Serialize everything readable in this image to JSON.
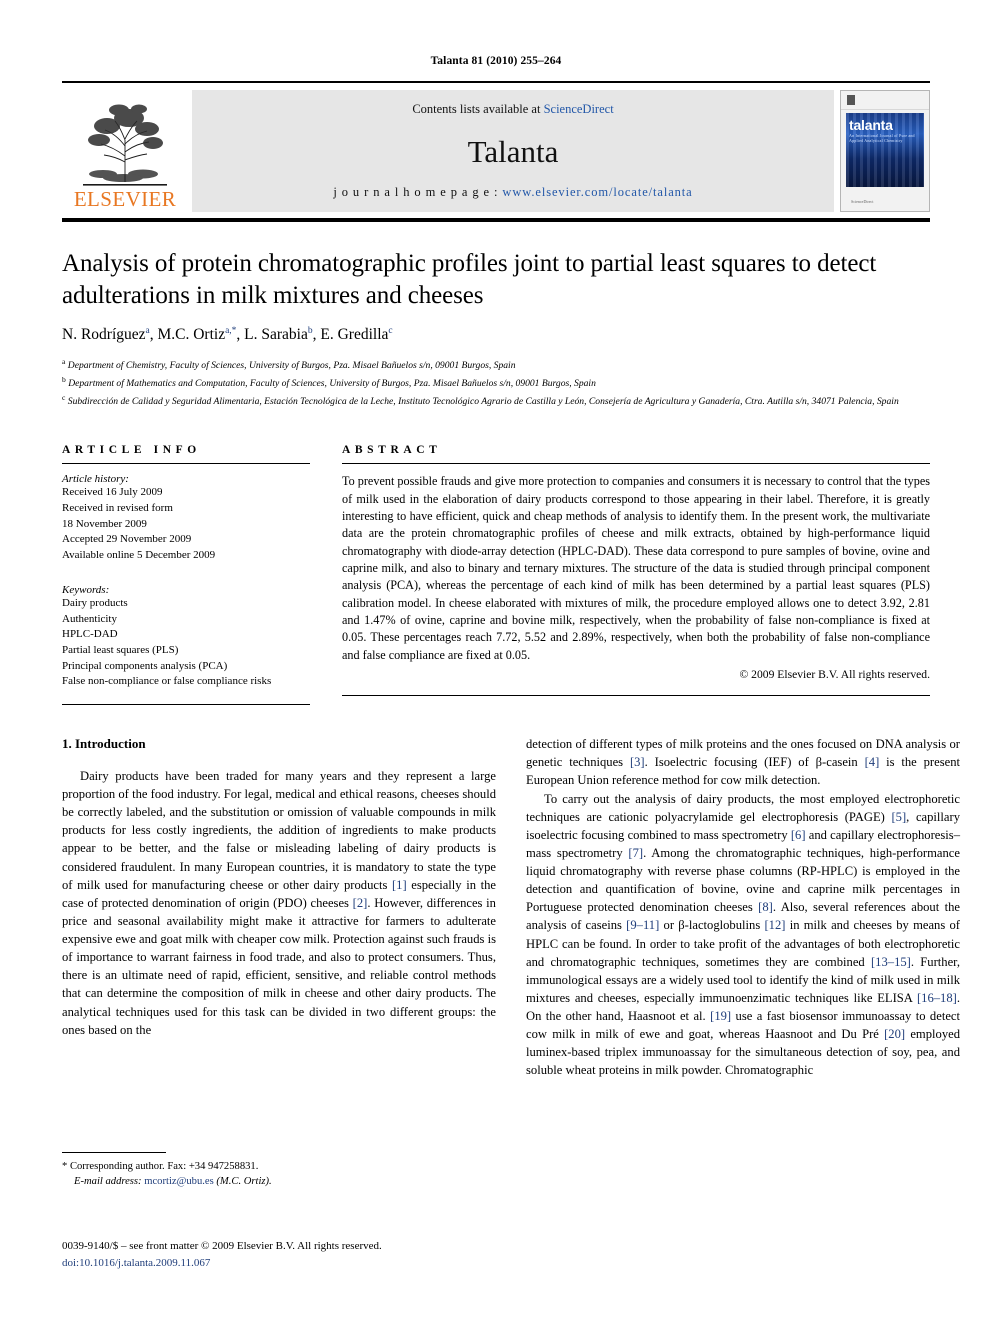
{
  "running_head": "Talanta 81 (2010) 255–264",
  "masthead": {
    "publisher_name": "ELSEVIER",
    "contents_prefix": "Contents lists available at ",
    "contents_link": "ScienceDirect",
    "journal_name": "Talanta",
    "homepage_prefix": "j o u r n a l   h o m e p a g e :  ",
    "homepage_url": "www.elsevier.com/locate/talanta",
    "cover_title": "talanta",
    "cover_subtitle": "An International Journal of Pure and Applied Analytical Chemistry",
    "cover_footer": "ScienceDirect"
  },
  "article": {
    "title": "Analysis of protein chromatographic profiles joint to partial least squares to detect adulterations in milk mixtures and cheeses",
    "authors_html": "N. Rodríguez<sup>a</sup>, M.C. Ortiz<sup>a,*</sup>, L. Sarabia<sup>b</sup>, E. Gredilla<sup>c</sup>",
    "affiliations": [
      {
        "marker": "a",
        "text": "Department of Chemistry, Faculty of Sciences, University of Burgos, Pza. Misael Bañuelos s/n, 09001 Burgos, Spain"
      },
      {
        "marker": "b",
        "text": "Department of Mathematics and Computation, Faculty of Sciences, University of Burgos, Pza. Misael Bañuelos s/n, 09001 Burgos, Spain"
      },
      {
        "marker": "c",
        "text": "Subdirección de Calidad y Seguridad Alimentaria, Estación Tecnológica de la Leche, Instituto Tecnológico Agrario de Castilla y León, Consejería de Agricultura y Ganadería, Ctra. Autilla s/n, 34071 Palencia, Spain"
      }
    ]
  },
  "article_info": {
    "heading": "ARTICLE INFO",
    "history_label": "Article history:",
    "history": [
      "Received 16 July 2009",
      "Received in revised form",
      "18 November 2009",
      "Accepted 29 November 2009",
      "Available online 5 December 2009"
    ],
    "keywords_label": "Keywords:",
    "keywords": [
      "Dairy products",
      "Authenticity",
      "HPLC-DAD",
      "Partial least squares (PLS)",
      "Principal components analysis (PCA)",
      "False non-compliance or false compliance risks"
    ]
  },
  "abstract": {
    "heading": "ABSTRACT",
    "text": "To prevent possible frauds and give more protection to companies and consumers it is necessary to control that the types of milk used in the elaboration of dairy products correspond to those appearing in their label. Therefore, it is greatly interesting to have efficient, quick and cheap methods of analysis to identify them. In the present work, the multivariate data are the protein chromatographic profiles of cheese and milk extracts, obtained by high-performance liquid chromatography with diode-array detection (HPLC-DAD). These data correspond to pure samples of bovine, ovine and caprine milk, and also to binary and ternary mixtures. The structure of the data is studied through principal component analysis (PCA), whereas the percentage of each kind of milk has been determined by a partial least squares (PLS) calibration model. In cheese elaborated with mixtures of milk, the procedure employed allows one to detect 3.92, 2.81 and 1.47% of ovine, caprine and bovine milk, respectively, when the probability of false non-compliance is fixed at 0.05. These percentages reach 7.72, 5.52 and 2.89%, respectively, when both the probability of false non-compliance and false compliance are fixed at 0.05.",
    "copyright": "© 2009 Elsevier B.V. All rights reserved."
  },
  "body": {
    "section_number_title": "1.  Introduction",
    "left_paragraph_1": "Dairy products have been traded for many years and they represent a large proportion of the food industry. For legal, medical and ethical reasons, cheeses should be correctly labeled, and the substitution or omission of valuable compounds in milk products for less costly ingredients, the addition of ingredients to make products appear to be better, and the false or misleading labeling of dairy products is considered fraudulent. In many European countries, it is mandatory to state the type of milk used for manufacturing cheese or other dairy products [1] especially in the case of protected denomination of origin (PDO) cheeses [2]. However, differences in price and seasonal availability might make it attractive for farmers to adulterate expensive ewe and goat milk with cheaper cow milk. Protection against such frauds is of importance to warrant fairness in food trade, and also to protect consumers. Thus, there is an ultimate need of rapid, efficient, sensitive, and reliable control methods that can determine the composition of milk in cheese and other dairy products. The analytical techniques used for this task can be divided in two different groups: the ones based on the",
    "right_paragraph_1": "detection of different types of milk proteins and the ones focused on DNA analysis or genetic techniques [3]. Isoelectric focusing (IEF) of β-casein [4] is the present European Union reference method for cow milk detection.",
    "right_paragraph_2": "To carry out the analysis of dairy products, the most employed electrophoretic techniques are cationic polyacrylamide gel electrophoresis (PAGE) [5], capillary isoelectric focusing combined to mass spectrometry [6] and capillary electrophoresis–mass spectrometry [7]. Among the chromatographic techniques, high-performance liquid chromatography with reverse phase columns (RP-HPLC) is employed in the detection and quantification of bovine, ovine and caprine milk percentages in Portuguese protected denomination cheeses [8]. Also, several references about the analysis of caseins [9–11] or β-lactoglobulins [12] in milk and cheeses by means of HPLC can be found. In order to take profit of the advantages of both electrophoretic and chromatographic techniques, sometimes they are combined [13–15]. Further, immunological essays are a widely used tool to identify the kind of milk used in milk mixtures and cheeses, especially immunoenzimatic techniques like ELISA [16–18]. On the other hand, Haasnoot et al. [19] use a fast biosensor immunoassay to detect cow milk in milk of ewe and goat, whereas Haasnoot and Du Pré [20] employed luminex-based triplex immunoassay for the simultaneous detection of soy, pea, and soluble wheat proteins in milk powder. Chromatographic"
  },
  "footnotes": {
    "corresponding": "*  Corresponding author. Fax: +34 947258831.",
    "email_label": "E-mail address:",
    "email": "mcortiz@ubu.es",
    "email_owner": "(M.C. Ortiz)."
  },
  "footer": {
    "front_matter": "0039-9140/$ – see front matter © 2009 Elsevier B.V. All rights reserved.",
    "doi_label": "doi:",
    "doi": "10.1016/j.talanta.2009.11.067"
  },
  "colors": {
    "link": "#2257a8",
    "reference": "#1f3d7a",
    "elsevier_orange": "#E87722",
    "band_gray": "#e6e6e6"
  }
}
